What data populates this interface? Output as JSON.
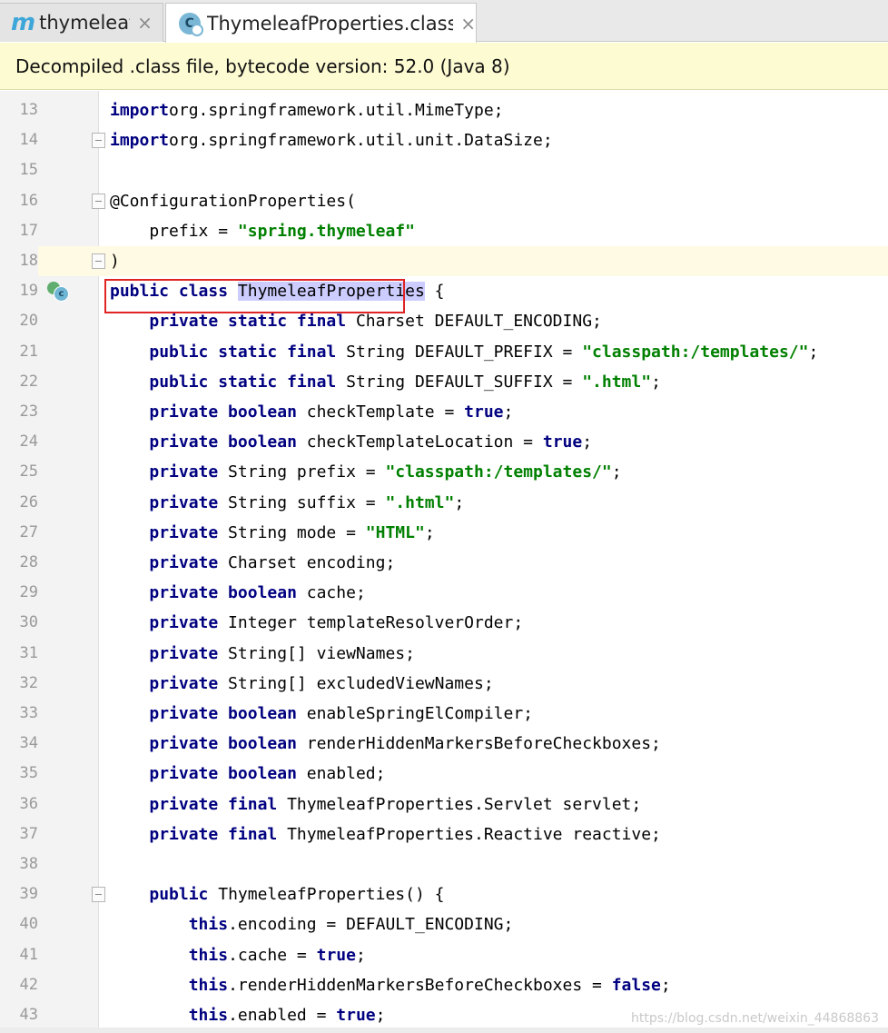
{
  "tabs": [
    {
      "icon": "maven-icon",
      "label": "thymeleaf"
    },
    {
      "icon": "class-file-icon",
      "label": "ThymeleafProperties.class"
    }
  ],
  "tab_close_glyph": "×",
  "banner": {
    "text": "Decompiled .class file, bytecode version: 52.0 (Java 8)"
  },
  "code_lines": [
    {
      "n": "13",
      "tokens": [
        [
          "kw",
          "import"
        ],
        [
          "",
          "org.springframework.util.MimeType;"
        ]
      ]
    },
    {
      "n": "14",
      "tokens": [
        [
          "kw",
          "import"
        ],
        [
          "",
          "org.springframework.util.unit.DataSize;"
        ]
      ]
    },
    {
      "n": "15",
      "tokens": []
    },
    {
      "n": "16",
      "tokens": [
        [
          "",
          "@ConfigurationProperties("
        ]
      ]
    },
    {
      "n": "17",
      "tokens": [
        [
          "",
          "    prefix = "
        ],
        [
          "str",
          "\"spring.thymeleaf\""
        ]
      ]
    },
    {
      "n": "18",
      "tokens": [
        [
          "",
          ")"
        ]
      ]
    },
    {
      "n": "19",
      "tokens": [
        [
          "kw",
          "public class"
        ],
        [
          "",
          " "
        ],
        [
          "hl",
          "ThymeleafProperties"
        ],
        [
          "",
          " {"
        ]
      ]
    },
    {
      "n": "20",
      "tokens": [
        [
          "",
          "    "
        ],
        [
          "kw",
          "private static final"
        ],
        [
          "",
          " Charset DEFAULT_ENCODING;"
        ]
      ]
    },
    {
      "n": "21",
      "tokens": [
        [
          "",
          "    "
        ],
        [
          "kw",
          "public static final"
        ],
        [
          "",
          " String DEFAULT_PREFIX = "
        ],
        [
          "str",
          "\"classpath:/templates/\""
        ],
        [
          "",
          ";"
        ]
      ]
    },
    {
      "n": "22",
      "tokens": [
        [
          "",
          "    "
        ],
        [
          "kw",
          "public static final"
        ],
        [
          "",
          " String DEFAULT_SUFFIX = "
        ],
        [
          "str",
          "\".html\""
        ],
        [
          "",
          ";"
        ]
      ]
    },
    {
      "n": "23",
      "tokens": [
        [
          "",
          "    "
        ],
        [
          "kw",
          "private boolean"
        ],
        [
          "",
          " checkTemplate = "
        ],
        [
          "kw",
          "true"
        ],
        [
          "",
          ";"
        ]
      ]
    },
    {
      "n": "24",
      "tokens": [
        [
          "",
          "    "
        ],
        [
          "kw",
          "private boolean"
        ],
        [
          "",
          " checkTemplateLocation = "
        ],
        [
          "kw",
          "true"
        ],
        [
          "",
          ";"
        ]
      ]
    },
    {
      "n": "25",
      "tokens": [
        [
          "",
          "    "
        ],
        [
          "kw",
          "private"
        ],
        [
          "",
          " String prefix = "
        ],
        [
          "str",
          "\"classpath:/templates/\""
        ],
        [
          "",
          ";"
        ]
      ]
    },
    {
      "n": "26",
      "tokens": [
        [
          "",
          "    "
        ],
        [
          "kw",
          "private"
        ],
        [
          "",
          " String suffix = "
        ],
        [
          "str",
          "\".html\""
        ],
        [
          "",
          ";"
        ]
      ]
    },
    {
      "n": "27",
      "tokens": [
        [
          "",
          "    "
        ],
        [
          "kw",
          "private"
        ],
        [
          "",
          " String mode = "
        ],
        [
          "str",
          "\"HTML\""
        ],
        [
          "",
          ";"
        ]
      ]
    },
    {
      "n": "28",
      "tokens": [
        [
          "",
          "    "
        ],
        [
          "kw",
          "private"
        ],
        [
          "",
          " Charset encoding;"
        ]
      ]
    },
    {
      "n": "29",
      "tokens": [
        [
          "",
          "    "
        ],
        [
          "kw",
          "private boolean"
        ],
        [
          "",
          " cache;"
        ]
      ]
    },
    {
      "n": "30",
      "tokens": [
        [
          "",
          "    "
        ],
        [
          "kw",
          "private"
        ],
        [
          "",
          " Integer templateResolverOrder;"
        ]
      ]
    },
    {
      "n": "31",
      "tokens": [
        [
          "",
          "    "
        ],
        [
          "kw",
          "private"
        ],
        [
          "",
          " String[] viewNames;"
        ]
      ]
    },
    {
      "n": "32",
      "tokens": [
        [
          "",
          "    "
        ],
        [
          "kw",
          "private"
        ],
        [
          "",
          " String[] excludedViewNames;"
        ]
      ]
    },
    {
      "n": "33",
      "tokens": [
        [
          "",
          "    "
        ],
        [
          "kw",
          "private boolean"
        ],
        [
          "",
          " enableSpringElCompiler;"
        ]
      ]
    },
    {
      "n": "34",
      "tokens": [
        [
          "",
          "    "
        ],
        [
          "kw",
          "private boolean"
        ],
        [
          "",
          " renderHiddenMarkersBeforeCheckboxes;"
        ]
      ]
    },
    {
      "n": "35",
      "tokens": [
        [
          "",
          "    "
        ],
        [
          "kw",
          "private boolean"
        ],
        [
          "",
          " enabled;"
        ]
      ]
    },
    {
      "n": "36",
      "tokens": [
        [
          "",
          "    "
        ],
        [
          "kw",
          "private final"
        ],
        [
          "",
          " ThymeleafProperties.Servlet servlet;"
        ]
      ]
    },
    {
      "n": "37",
      "tokens": [
        [
          "",
          "    "
        ],
        [
          "kw",
          "private final"
        ],
        [
          "",
          " ThymeleafProperties.Reactive reactive;"
        ]
      ]
    },
    {
      "n": "38",
      "tokens": []
    },
    {
      "n": "39",
      "tokens": [
        [
          "",
          "    "
        ],
        [
          "kw",
          "public"
        ],
        [
          "",
          " ThymeleafProperties() {"
        ]
      ]
    },
    {
      "n": "40",
      "tokens": [
        [
          "",
          "        "
        ],
        [
          "kw",
          "this"
        ],
        [
          "",
          ".encoding = DEFAULT_ENCODING;"
        ]
      ]
    },
    {
      "n": "41",
      "tokens": [
        [
          "",
          "        "
        ],
        [
          "kw",
          "this"
        ],
        [
          "",
          ".cache = "
        ],
        [
          "kw",
          "true"
        ],
        [
          "",
          ";"
        ]
      ]
    },
    {
      "n": "42",
      "tokens": [
        [
          "",
          "        "
        ],
        [
          "kw",
          "this"
        ],
        [
          "",
          ".renderHiddenMarkersBeforeCheckboxes = "
        ],
        [
          "kw",
          "false"
        ],
        [
          "",
          ";"
        ]
      ]
    },
    {
      "n": "43",
      "tokens": [
        [
          "",
          "        "
        ],
        [
          "kw",
          "this"
        ],
        [
          "",
          ".enabled = "
        ],
        [
          "kw",
          "true"
        ],
        [
          "",
          ";"
        ]
      ]
    }
  ],
  "current_line": "18",
  "fold_lines": [
    "14",
    "16",
    "18",
    "39"
  ],
  "class_marker_line": "19",
  "class_marker_letter": "c",
  "tab_class_icon_letter": "C",
  "highlight_box_line": "16",
  "colors": {
    "keyword": "#000080",
    "string": "#008000",
    "highlight": "#ccccff",
    "annotation_box": "#e02424",
    "banner_bg": "#fdfbd2"
  },
  "watermark": "https://blog.csdn.net/weixin_44868863"
}
